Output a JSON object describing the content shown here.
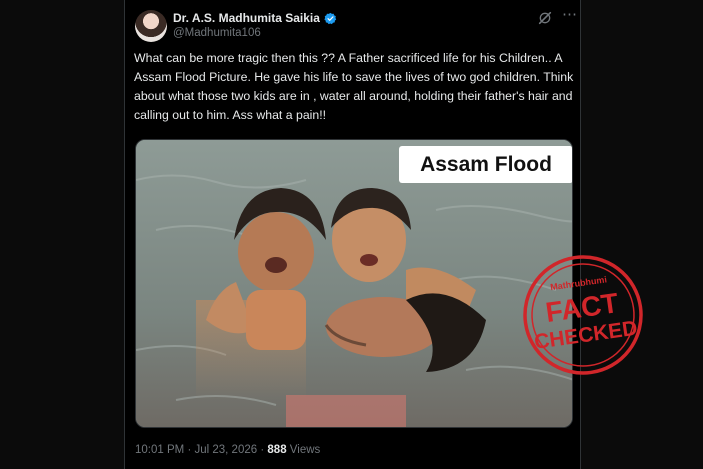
{
  "tweet": {
    "author_name": "Dr. A.S. Madhumita Saikia",
    "handle": "@Madhumita106",
    "text": "What can be more tragic then this ?? A Father sacrificed life for his Children.. A Assam Flood Picture. He gave his life to save the lives of two god children. Think about what those two kids are in , water all around, holding their father's hair and calling out to him. Ass what a pain!!",
    "media_badge": "Assam Flood",
    "time": "10:01 PM",
    "separator": "·",
    "date": "Jul 23, 2026",
    "views_count": "888",
    "views_label": "Views"
  },
  "stamp": {
    "brand": "Mathrubhumi",
    "line1": "FACT",
    "line2": "CHECKED"
  },
  "icons": {
    "verified": "verified-badge-icon",
    "grok": "grok-icon",
    "more": "more-options-icon"
  },
  "colors": {
    "background": "#000000",
    "text": "#e7e9ea",
    "muted": "#71767b",
    "verified": "#1d9bf0",
    "stamp_red": "#d1262a"
  }
}
